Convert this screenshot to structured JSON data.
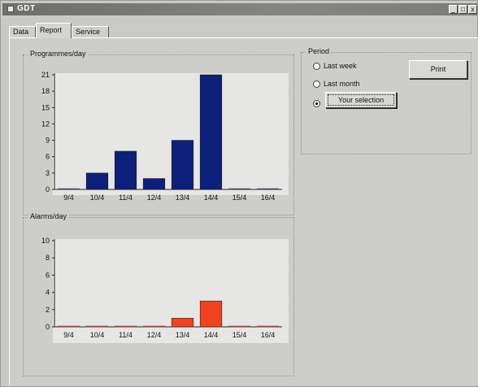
{
  "window": {
    "title": "GDT",
    "minimize": "_",
    "maximize": "□",
    "close": "x"
  },
  "tabs": [
    {
      "label": "Data",
      "active": false
    },
    {
      "label": "Report",
      "active": true
    },
    {
      "label": "Service",
      "active": false
    }
  ],
  "period": {
    "label": "Period",
    "options": [
      {
        "label": "Last week",
        "checked": false
      },
      {
        "label": "Last month",
        "checked": false
      },
      {
        "label": "Your selection",
        "checked": true
      }
    ],
    "print_label": "Print"
  },
  "chart_data": [
    {
      "type": "bar",
      "title": "Programmes/day",
      "categories": [
        "9/4",
        "10/4",
        "11/4",
        "12/4",
        "13/4",
        "14/4",
        "15/4",
        "16/4"
      ],
      "values": [
        0,
        3,
        7,
        2,
        9,
        21,
        0,
        0
      ],
      "ylim": [
        0,
        21
      ],
      "yticks": [
        0,
        3,
        6,
        9,
        12,
        15,
        18,
        21
      ],
      "color": "#0c1f7a",
      "grid": false
    },
    {
      "type": "bar",
      "title": "Alarms/day",
      "categories": [
        "9/4",
        "10/4",
        "11/4",
        "12/4",
        "13/4",
        "14/4",
        "15/4",
        "16/4"
      ],
      "values": [
        0,
        0,
        0,
        0,
        1,
        3,
        0,
        0
      ],
      "ylim": [
        0,
        10
      ],
      "yticks": [
        0,
        2,
        4,
        6,
        8,
        10
      ],
      "color": "#f2411e",
      "grid": false
    }
  ]
}
